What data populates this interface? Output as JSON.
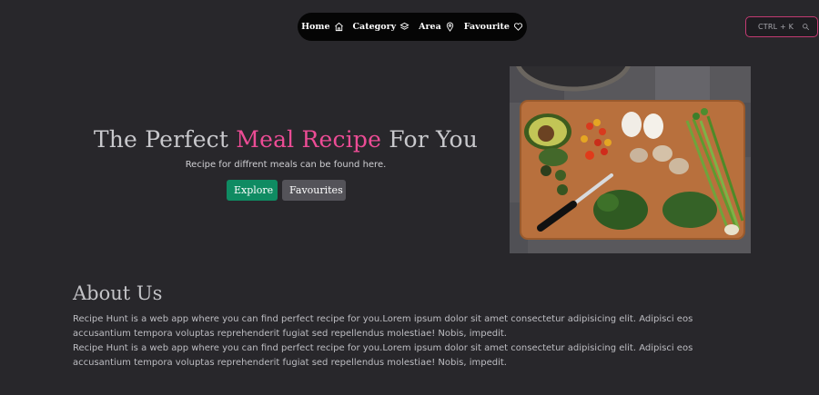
{
  "nav": {
    "items": [
      {
        "label": "Home",
        "icon": "home-icon"
      },
      {
        "label": "Category",
        "icon": "layers-icon"
      },
      {
        "label": "Area",
        "icon": "map-pin-icon"
      },
      {
        "label": "Favourite",
        "icon": "heart-icon"
      }
    ]
  },
  "search": {
    "shortcut": "CTRL + K",
    "icon": "search-icon"
  },
  "hero": {
    "title_prefix": "The Perfect ",
    "title_accent": "Meal Recipe",
    "title_suffix": " For You",
    "subtitle": "Recipe for diffrent meals can be found here.",
    "explore_label": "Explore",
    "favourites_label": "Favourites",
    "image_icon": "food-cutting-board-image"
  },
  "about": {
    "title": "About Us",
    "paragraphs": [
      "Recipe Hunt is a web app where you can find perfect recipe for you.Lorem ipsum dolor sit amet consectetur adipisicing elit. Adipisci eos accusantium tempora voluptas reprehenderit fugiat sed repellendus molestiae! Nobis, impedit.",
      "Recipe Hunt is a web app where you can find perfect recipe for you.Lorem ipsum dolor sit amet consectetur adipisicing elit. Adipisci eos accusantium tempora voluptas reprehenderit fugiat sed repellendus molestiae! Nobis, impedit."
    ]
  },
  "colors": {
    "background": "#28272b",
    "accent": "#ec4c95",
    "explore": "#0f8b62",
    "favourites": "#545359",
    "search_border": "#c23a72"
  }
}
